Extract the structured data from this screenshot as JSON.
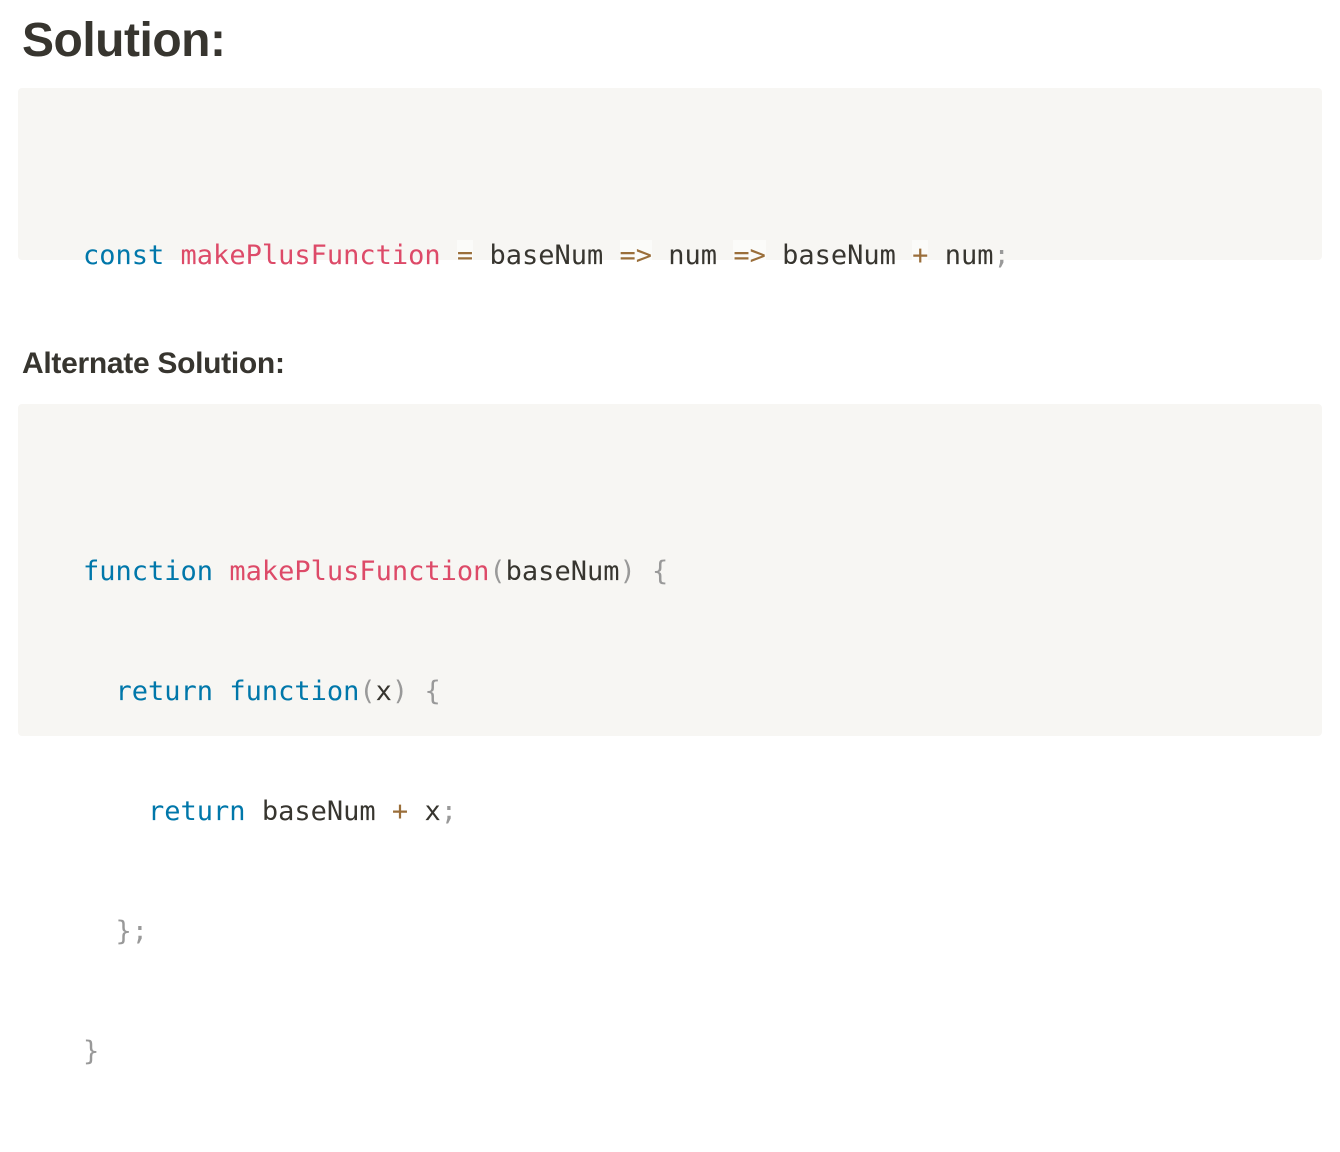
{
  "headings": {
    "solution": "Solution:",
    "alternate": "Alternate Solution:"
  },
  "code1": {
    "line1": {
      "kw_const": "const",
      "fn_name": "makePlusFunction",
      "op_eq": "=",
      "param_base": "baseNum",
      "op_arrow1": "=>",
      "param_num": "num",
      "op_arrow2": "=>",
      "ref_base": "baseNum",
      "op_plus": "+",
      "ref_num": "num",
      "semi": ";"
    }
  },
  "code2": {
    "line1": {
      "kw_function": "function",
      "fn_name": "makePlusFunction",
      "paren_open": "(",
      "param": "baseNum",
      "paren_close": ")",
      "brace_open": "{"
    },
    "line2": {
      "indent": "  ",
      "kw_return": "return",
      "kw_function": "function",
      "paren_open": "(",
      "param": "x",
      "paren_close": ")",
      "brace_open": "{"
    },
    "line3": {
      "indent": "    ",
      "kw_return": "return",
      "ref_base": "baseNum",
      "op_plus": "+",
      "ref_x": "x",
      "semi": ";"
    },
    "line4": {
      "indent": "  ",
      "brace_close": "}",
      "semi": ";"
    },
    "line5": {
      "brace_close": "}"
    }
  }
}
